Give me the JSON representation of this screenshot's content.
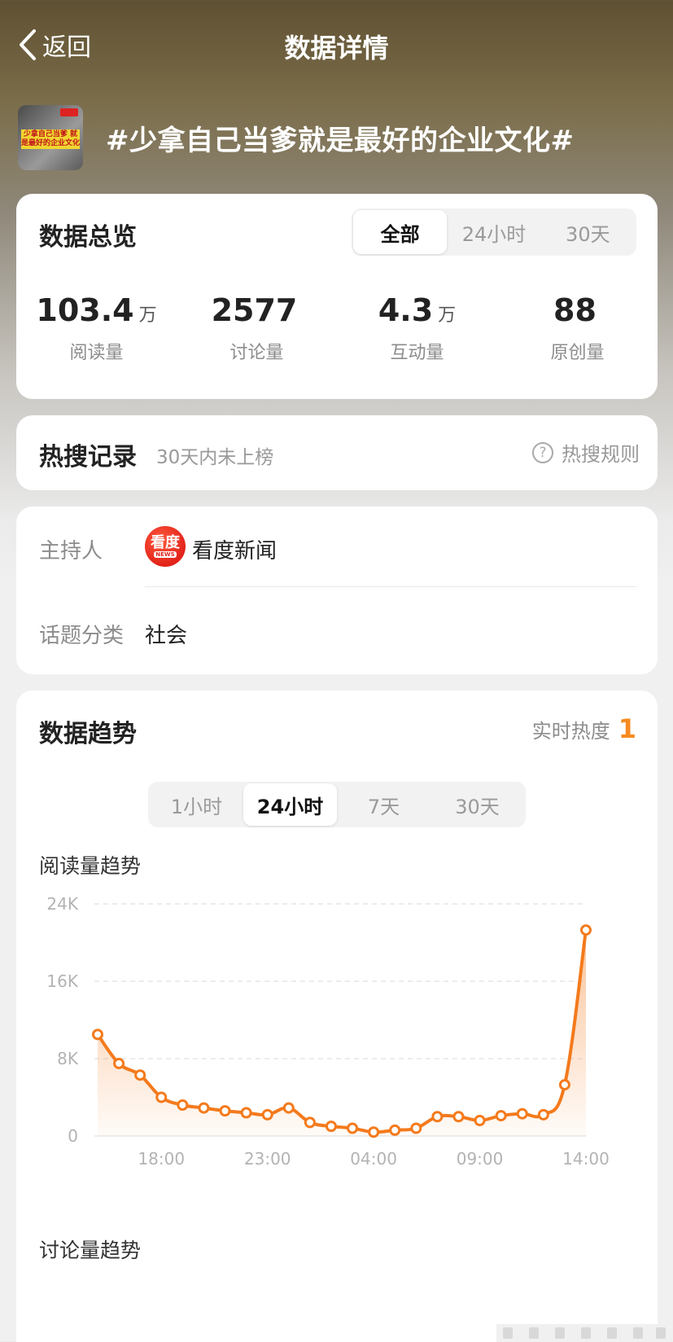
{
  "header": {
    "back_label": "返回",
    "title": "数据详情"
  },
  "topic": {
    "title": "#少拿自己当爹就是最好的企业文化#",
    "thumbnail_caption": "少拿自己当爹 就是最好的企业文化"
  },
  "overview": {
    "title": "数据总览",
    "tabs": [
      "全部",
      "24小时",
      "30天"
    ],
    "active_tab": "全部",
    "stats": [
      {
        "value": "103.4",
        "unit": "万",
        "label": "阅读量"
      },
      {
        "value": "2577",
        "unit": "",
        "label": "讨论量"
      },
      {
        "value": "4.3",
        "unit": "万",
        "label": "互动量"
      },
      {
        "value": "88",
        "unit": "",
        "label": "原创量"
      }
    ]
  },
  "hot_search": {
    "title": "热搜记录",
    "subtitle": "30天内未上榜",
    "rule_label": "热搜规则",
    "rule_icon": "question-circle-icon"
  },
  "info": {
    "host_label": "主持人",
    "host_name": "看度新闻",
    "host_logo_text": "看度",
    "host_logo_sub": "NEWS",
    "category_label": "话题分类",
    "category_value": "社会"
  },
  "trend": {
    "title": "数据趋势",
    "realtime_label": "实时热度",
    "realtime_value": "1",
    "tabs": [
      "1小时",
      "24小时",
      "7天",
      "30天"
    ],
    "active_tab": "24小时",
    "read_trend_title": "阅读量趋势",
    "discuss_trend_title": "讨论量趋势"
  },
  "colors": {
    "accent": "#f68b1f",
    "line": "#f47a1c"
  },
  "chart_data": {
    "type": "area",
    "title": "阅读量趋势",
    "y_ticks": [
      "0",
      "8K",
      "16K",
      "24K"
    ],
    "ylim": [
      0,
      24000
    ],
    "x_ticks": [
      "18:00",
      "23:00",
      "04:00",
      "09:00",
      "14:00"
    ],
    "x_tick_index": [
      3,
      8,
      13,
      18,
      23
    ],
    "grid": true,
    "series": [
      {
        "values": [
          10500,
          7500,
          6300,
          4000,
          3200,
          2900,
          2600,
          2400,
          2200,
          2900,
          1400,
          1000,
          800,
          400,
          600,
          800,
          2000,
          2000,
          1600,
          2100,
          2300,
          2200,
          5300,
          21300
        ]
      }
    ]
  }
}
